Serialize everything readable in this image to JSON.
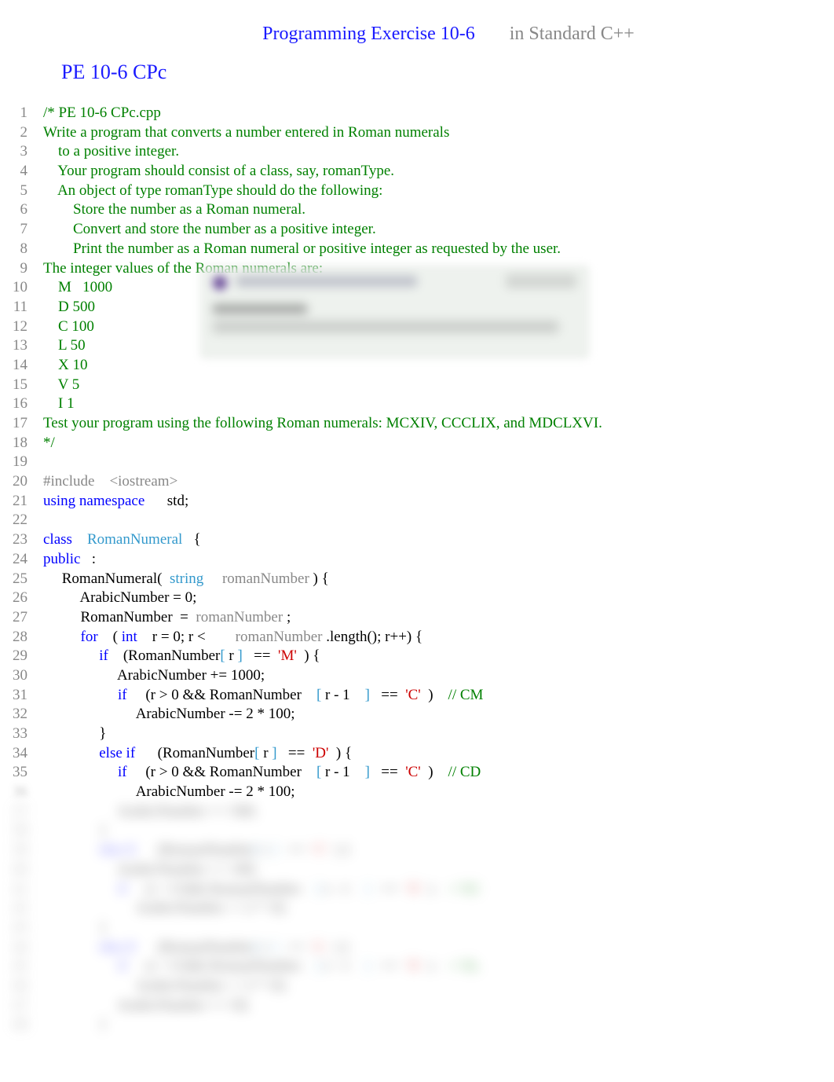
{
  "header": {
    "title": "Programming Exercise 10-6",
    "subtitle": "in Standard C++"
  },
  "page_title": "PE 10-6 CPc",
  "lines": [
    {
      "n": 1,
      "segments": [
        {
          "cls": "comment",
          "t": "/* PE 10-6 CPc.cpp"
        }
      ]
    },
    {
      "n": 2,
      "segments": [
        {
          "cls": "comment",
          "t": "Write a program that converts a number entered in Roman numerals"
        }
      ]
    },
    {
      "n": 3,
      "segments": [
        {
          "cls": "comment",
          "t": "    to a positive integer."
        }
      ]
    },
    {
      "n": 4,
      "segments": [
        {
          "cls": "comment",
          "t": "    Your program should consist of a class, say, romanType."
        }
      ]
    },
    {
      "n": 5,
      "segments": [
        {
          "cls": "comment",
          "t": "    An object of type romanType should do the following:"
        }
      ]
    },
    {
      "n": 6,
      "segments": [
        {
          "cls": "comment",
          "t": "        Store the number as a Roman numeral."
        }
      ]
    },
    {
      "n": 7,
      "segments": [
        {
          "cls": "comment",
          "t": "        Convert and store the number as a positive integer."
        }
      ]
    },
    {
      "n": 8,
      "segments": [
        {
          "cls": "comment",
          "t": "        Print the number as a Roman numeral or positive integer as requested by the user."
        }
      ]
    },
    {
      "n": 9,
      "segments": [
        {
          "cls": "comment",
          "t": "The integer values of the Roman numerals are:"
        }
      ]
    },
    {
      "n": 10,
      "segments": [
        {
          "cls": "comment",
          "t": "    M   1000"
        }
      ]
    },
    {
      "n": 11,
      "segments": [
        {
          "cls": "comment",
          "t": "    D 500"
        }
      ]
    },
    {
      "n": 12,
      "segments": [
        {
          "cls": "comment",
          "t": "    C 100"
        }
      ]
    },
    {
      "n": 13,
      "segments": [
        {
          "cls": "comment",
          "t": "    L 50"
        }
      ]
    },
    {
      "n": 14,
      "segments": [
        {
          "cls": "comment",
          "t": "    X 10"
        }
      ]
    },
    {
      "n": 15,
      "segments": [
        {
          "cls": "comment",
          "t": "    V 5"
        }
      ]
    },
    {
      "n": 16,
      "segments": [
        {
          "cls": "comment",
          "t": "    I 1"
        }
      ]
    },
    {
      "n": 17,
      "segments": [
        {
          "cls": "comment",
          "t": "Test your program using the following Roman numerals: MCXIV, CCCLIX, and MDCLXVI."
        }
      ]
    },
    {
      "n": 18,
      "segments": [
        {
          "cls": "comment",
          "t": "*/"
        }
      ]
    },
    {
      "n": 19,
      "segments": []
    },
    {
      "n": 20,
      "segments": [
        {
          "cls": "preprocessor",
          "t": "#include"
        },
        {
          "cls": "black",
          "t": "    "
        },
        {
          "cls": "include-path",
          "t": "<iostream>"
        }
      ]
    },
    {
      "n": 21,
      "segments": [
        {
          "cls": "keyword",
          "t": "using namespace"
        },
        {
          "cls": "black",
          "t": "      std;"
        }
      ]
    },
    {
      "n": 22,
      "segments": []
    },
    {
      "n": 23,
      "segments": [
        {
          "cls": "keyword",
          "t": "class"
        },
        {
          "cls": "black",
          "t": "    "
        },
        {
          "cls": "type",
          "t": "RomanNumeral"
        },
        {
          "cls": "black",
          "t": "   {"
        }
      ]
    },
    {
      "n": 24,
      "segments": [
        {
          "cls": "keyword",
          "t": "public"
        },
        {
          "cls": "black",
          "t": "   :"
        }
      ]
    },
    {
      "n": 25,
      "segments": [
        {
          "cls": "black",
          "t": "     RomanNumeral(  "
        },
        {
          "cls": "type",
          "t": "string"
        },
        {
          "cls": "black",
          "t": "     "
        },
        {
          "cls": "param",
          "t": "romanNumber"
        },
        {
          "cls": "black",
          "t": " ) {"
        }
      ]
    },
    {
      "n": 26,
      "segments": [
        {
          "cls": "black",
          "t": "          ArabicNumber = 0;"
        }
      ]
    },
    {
      "n": 27,
      "segments": [
        {
          "cls": "black",
          "t": "          RomanNumber  =  "
        },
        {
          "cls": "param",
          "t": "romanNumber"
        },
        {
          "cls": "black",
          "t": " ;"
        }
      ]
    },
    {
      "n": 28,
      "segments": [
        {
          "cls": "black",
          "t": "          "
        },
        {
          "cls": "keyword",
          "t": "for"
        },
        {
          "cls": "black",
          "t": "    ( "
        },
        {
          "cls": "keyword",
          "t": "int"
        },
        {
          "cls": "black",
          "t": "    r = 0; r <        "
        },
        {
          "cls": "param",
          "t": "romanNumber"
        },
        {
          "cls": "black",
          "t": " .length(); r++) {"
        }
      ]
    },
    {
      "n": 29,
      "segments": [
        {
          "cls": "black",
          "t": "               "
        },
        {
          "cls": "keyword",
          "t": "if"
        },
        {
          "cls": "black",
          "t": "    (RomanNumber"
        },
        {
          "cls": "bracket",
          "t": "["
        },
        {
          "cls": "black",
          "t": " r "
        },
        {
          "cls": "bracket",
          "t": "]"
        },
        {
          "cls": "black",
          "t": "   ==  "
        },
        {
          "cls": "string-char",
          "t": "'M'"
        },
        {
          "cls": "black",
          "t": "  ) {"
        }
      ]
    },
    {
      "n": 30,
      "segments": [
        {
          "cls": "black",
          "t": "                    ArabicNumber += 1000;"
        }
      ]
    },
    {
      "n": 31,
      "segments": [
        {
          "cls": "black",
          "t": "                    "
        },
        {
          "cls": "keyword",
          "t": "if"
        },
        {
          "cls": "black",
          "t": "     (r > 0 && RomanNumber    "
        },
        {
          "cls": "bracket",
          "t": "["
        },
        {
          "cls": "black",
          "t": " r - 1    "
        },
        {
          "cls": "bracket",
          "t": "]"
        },
        {
          "cls": "black",
          "t": "   ==  "
        },
        {
          "cls": "string-char",
          "t": "'C'"
        },
        {
          "cls": "black",
          "t": "  )    "
        },
        {
          "cls": "comment",
          "t": "// CM"
        }
      ]
    },
    {
      "n": 32,
      "segments": [
        {
          "cls": "black",
          "t": "                         ArabicNumber -= 2 * 100;"
        }
      ]
    },
    {
      "n": 33,
      "segments": [
        {
          "cls": "black",
          "t": "               }"
        }
      ]
    },
    {
      "n": 34,
      "segments": [
        {
          "cls": "black",
          "t": "               "
        },
        {
          "cls": "keyword",
          "t": "else if"
        },
        {
          "cls": "black",
          "t": "      (RomanNumber"
        },
        {
          "cls": "bracket",
          "t": "["
        },
        {
          "cls": "black",
          "t": " r "
        },
        {
          "cls": "bracket",
          "t": "]"
        },
        {
          "cls": "black",
          "t": "   ==  "
        },
        {
          "cls": "string-char",
          "t": "'D'"
        },
        {
          "cls": "black",
          "t": "  ) {"
        }
      ]
    },
    {
      "n": 35,
      "segments": [
        {
          "cls": "black",
          "t": "                    "
        },
        {
          "cls": "keyword",
          "t": "if"
        },
        {
          "cls": "black",
          "t": "     (r > 0 && RomanNumber    "
        },
        {
          "cls": "bracket",
          "t": "["
        },
        {
          "cls": "black",
          "t": " r - 1    "
        },
        {
          "cls": "bracket",
          "t": "]"
        },
        {
          "cls": "black",
          "t": "   ==  "
        },
        {
          "cls": "string-char",
          "t": "'C'"
        },
        {
          "cls": "black",
          "t": "  )    "
        },
        {
          "cls": "comment",
          "t": "// CD"
        }
      ]
    },
    {
      "n": 36,
      "visible_only": true,
      "segments": [
        {
          "cls": "black",
          "t": "                         ArabicNumber -= 2 * 100;"
        }
      ]
    }
  ],
  "blurred_lines": [
    {
      "n": 36,
      "segments": []
    },
    {
      "n": 37,
      "segments": [
        {
          "cls": "black",
          "t": "                    ArabicNumber += 500;"
        }
      ]
    },
    {
      "n": 38,
      "segments": [
        {
          "cls": "black",
          "t": "               }"
        }
      ]
    },
    {
      "n": 39,
      "segments": [
        {
          "cls": "black",
          "t": "               "
        },
        {
          "cls": "keyword",
          "t": "else if"
        },
        {
          "cls": "black",
          "t": "      (RomanNumber"
        },
        {
          "cls": "bracket",
          "t": "["
        },
        {
          "cls": "black",
          "t": " r "
        },
        {
          "cls": "bracket",
          "t": "]"
        },
        {
          "cls": "black",
          "t": "   ==  "
        },
        {
          "cls": "string-char",
          "t": "'C'"
        },
        {
          "cls": "black",
          "t": "  ) {"
        }
      ]
    },
    {
      "n": 40,
      "segments": [
        {
          "cls": "black",
          "t": "                    ArabicNumber += 100;"
        }
      ]
    },
    {
      "n": 41,
      "segments": [
        {
          "cls": "black",
          "t": "                    "
        },
        {
          "cls": "keyword",
          "t": "if"
        },
        {
          "cls": "black",
          "t": "     (r > 0 && RomanNumber    "
        },
        {
          "cls": "bracket",
          "t": "["
        },
        {
          "cls": "black",
          "t": " r - 1    "
        },
        {
          "cls": "bracket",
          "t": "]"
        },
        {
          "cls": "black",
          "t": "   ==  "
        },
        {
          "cls": "string-char",
          "t": "'X'"
        },
        {
          "cls": "black",
          "t": "  )    "
        },
        {
          "cls": "comment",
          "t": "// XC"
        }
      ]
    },
    {
      "n": 42,
      "segments": [
        {
          "cls": "black",
          "t": "                         ArabicNumber -= 2 * 10;"
        }
      ]
    },
    {
      "n": 43,
      "segments": [
        {
          "cls": "black",
          "t": "               }"
        }
      ]
    },
    {
      "n": 44,
      "segments": [
        {
          "cls": "black",
          "t": "               "
        },
        {
          "cls": "keyword",
          "t": "else if"
        },
        {
          "cls": "black",
          "t": "      (RomanNumber"
        },
        {
          "cls": "bracket",
          "t": "["
        },
        {
          "cls": "black",
          "t": " r "
        },
        {
          "cls": "bracket",
          "t": "]"
        },
        {
          "cls": "black",
          "t": "   ==  "
        },
        {
          "cls": "string-char",
          "t": "'L'"
        },
        {
          "cls": "black",
          "t": "  ) {"
        }
      ]
    },
    {
      "n": 45,
      "segments": [
        {
          "cls": "black",
          "t": "                    "
        },
        {
          "cls": "keyword",
          "t": "if"
        },
        {
          "cls": "black",
          "t": "     (r > 0 && RomanNumber    "
        },
        {
          "cls": "bracket",
          "t": "["
        },
        {
          "cls": "black",
          "t": " r - 1    "
        },
        {
          "cls": "bracket",
          "t": "]"
        },
        {
          "cls": "black",
          "t": "   ==  "
        },
        {
          "cls": "string-char",
          "t": "'X'"
        },
        {
          "cls": "black",
          "t": "  )    "
        },
        {
          "cls": "comment",
          "t": "// XL"
        }
      ]
    },
    {
      "n": 46,
      "segments": [
        {
          "cls": "black",
          "t": "                         ArabicNumber -= 2 * 10;"
        }
      ]
    },
    {
      "n": 47,
      "segments": [
        {
          "cls": "black",
          "t": "                    ArabicNumber += 50;"
        }
      ]
    },
    {
      "n": 48,
      "segments": [
        {
          "cls": "black",
          "t": "               }"
        }
      ]
    }
  ]
}
